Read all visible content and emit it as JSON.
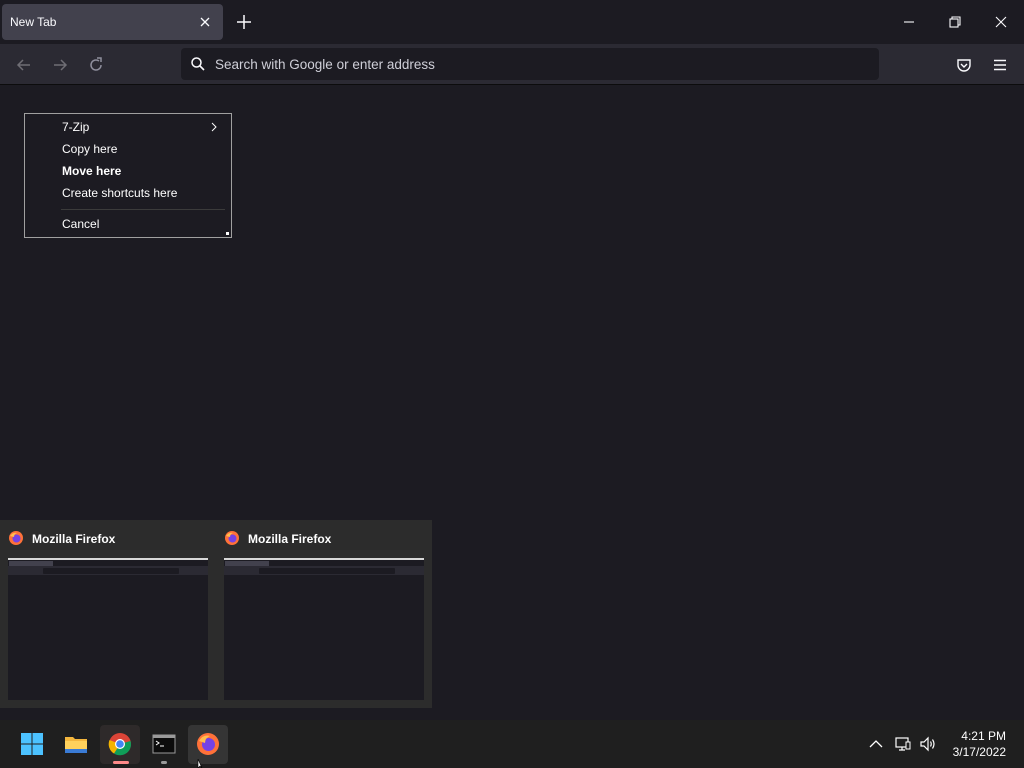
{
  "browser": {
    "tab": {
      "title": "New Tab"
    },
    "urlbar": {
      "placeholder": "Search with Google or enter address"
    }
  },
  "context_menu": {
    "items": [
      {
        "label": "7-Zip",
        "has_submenu": true,
        "bold": false
      },
      {
        "label": "Copy here",
        "bold": false
      },
      {
        "label": "Move here",
        "bold": true
      },
      {
        "label": "Create shortcuts here",
        "bold": false
      },
      {
        "label": "Cancel",
        "bold": false
      }
    ]
  },
  "thumbnails": [
    {
      "title": "Mozilla Firefox"
    },
    {
      "title": "Mozilla Firefox"
    }
  ],
  "taskbar": {
    "apps": [
      "start-icon",
      "file-explorer-icon",
      "chrome-icon",
      "terminal-icon",
      "firefox-icon"
    ],
    "clock": {
      "time": "4:21 PM",
      "date": "3/17/2022"
    }
  },
  "colors": {
    "background": "#1c1b22",
    "toolbar": "#2b2a33",
    "tab_selected": "#42414d",
    "taskbar": "#1f1f1f",
    "accent_windows": "#4cc2ff"
  }
}
